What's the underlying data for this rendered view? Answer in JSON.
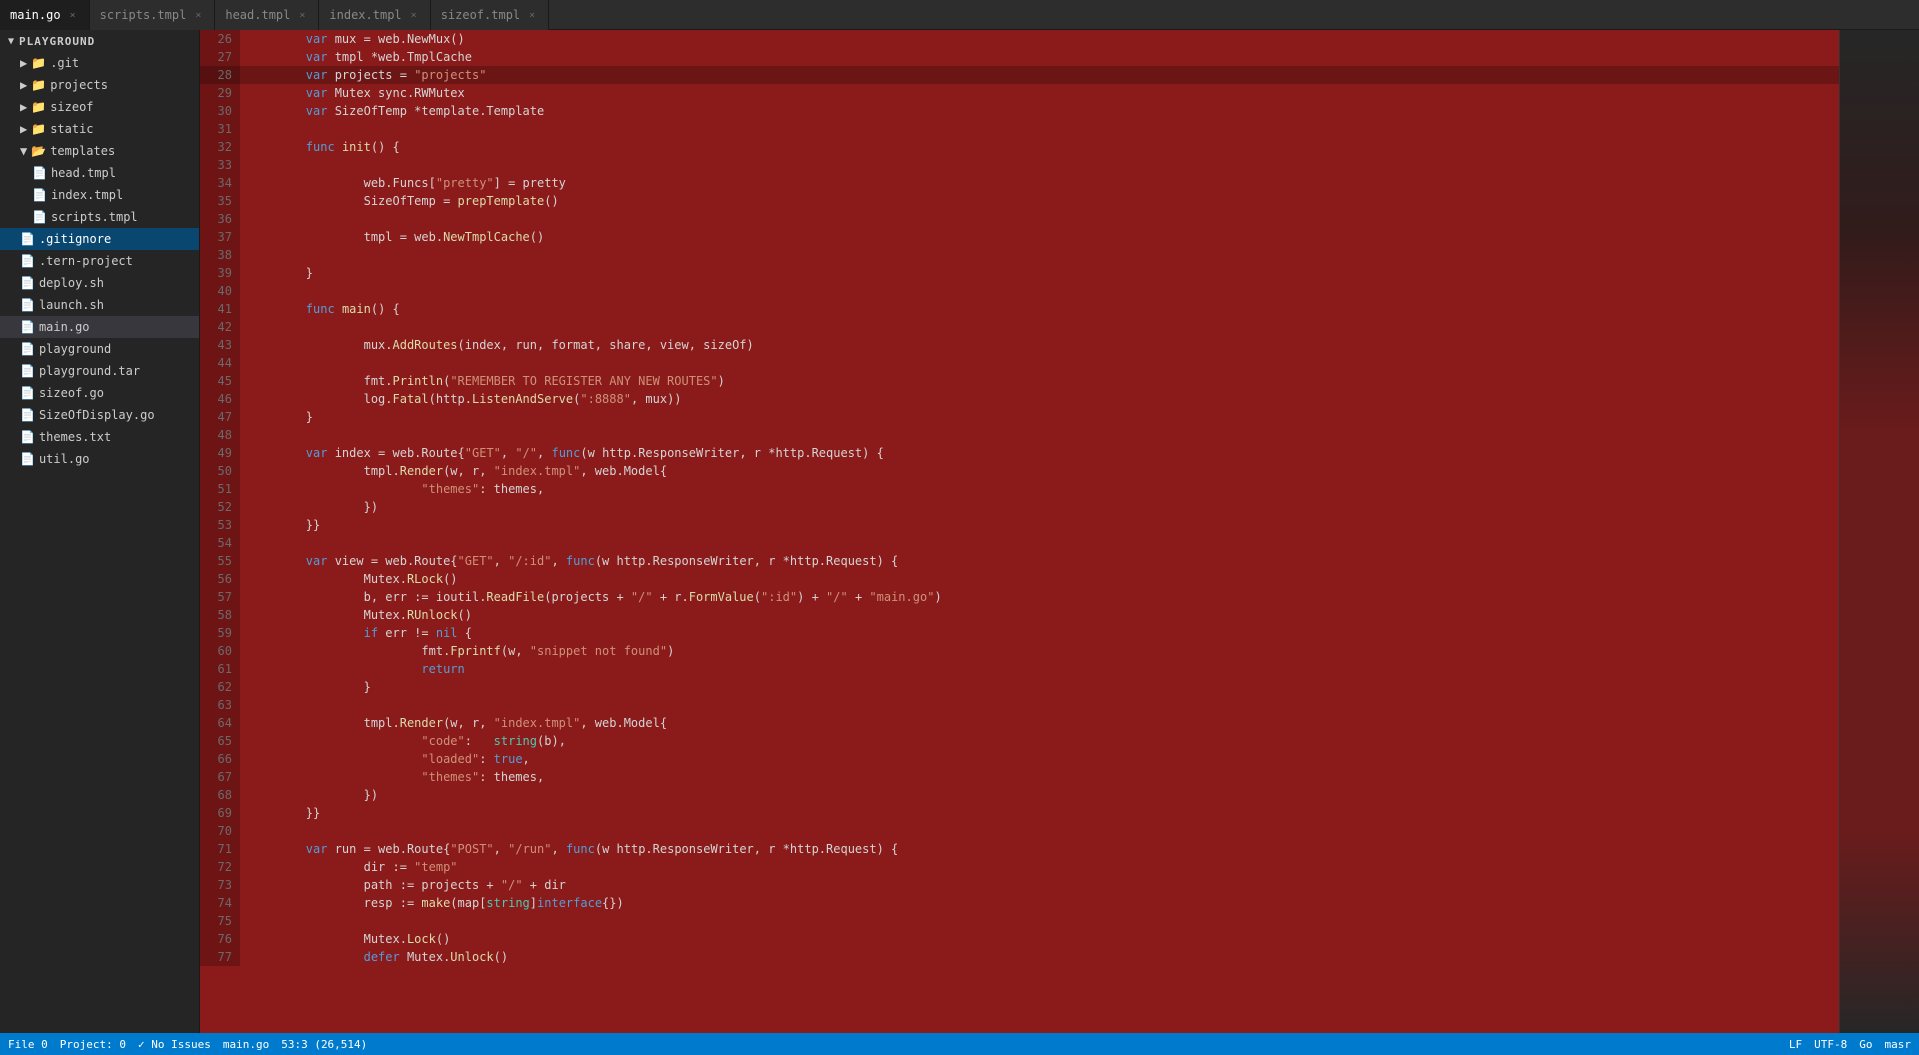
{
  "app": {
    "title": "playground"
  },
  "tabs": [
    {
      "id": "main.go",
      "label": "main.go",
      "active": true,
      "modified": false
    },
    {
      "id": "scripts.tmpl",
      "label": "scripts.tmpl",
      "active": false,
      "modified": false
    },
    {
      "id": "head.tmpl",
      "label": "head.tmpl",
      "active": false,
      "modified": false
    },
    {
      "id": "index.tmpl",
      "label": "index.tmpl",
      "active": false,
      "modified": false
    },
    {
      "id": "sizeof.tmpl",
      "label": "sizeof.tmpl",
      "active": false,
      "modified": false
    }
  ],
  "sidebar": {
    "root_label": "playground",
    "items": [
      {
        "id": "git",
        "label": ".git",
        "type": "folder",
        "indent": 1,
        "collapsed": true
      },
      {
        "id": "projects",
        "label": "projects",
        "type": "folder",
        "indent": 1,
        "collapsed": true
      },
      {
        "id": "sizeof",
        "label": "sizeof",
        "type": "folder",
        "indent": 1,
        "collapsed": true
      },
      {
        "id": "static",
        "label": "static",
        "type": "folder",
        "indent": 1,
        "collapsed": true
      },
      {
        "id": "templates",
        "label": "templates",
        "type": "folder",
        "indent": 1,
        "collapsed": false
      },
      {
        "id": "head.tmpl",
        "label": "head.tmpl",
        "type": "tmpl",
        "indent": 2
      },
      {
        "id": "index.tmpl",
        "label": "index.tmpl",
        "type": "tmpl",
        "indent": 2
      },
      {
        "id": "scripts.tmpl",
        "label": "scripts.tmpl",
        "type": "tmpl",
        "indent": 2
      },
      {
        "id": ".gitignore",
        "label": ".gitignore",
        "type": "git",
        "indent": 1,
        "selected": true
      },
      {
        "id": ".tern-project",
        "label": ".tern-project",
        "type": "txt",
        "indent": 1
      },
      {
        "id": "deploy.sh",
        "label": "deploy.sh",
        "type": "sh",
        "indent": 1
      },
      {
        "id": "launch.sh",
        "label": "launch.sh",
        "type": "sh",
        "indent": 1
      },
      {
        "id": "main.go",
        "label": "main.go",
        "type": "go",
        "indent": 1,
        "active": true
      },
      {
        "id": "playground",
        "label": "playground",
        "type": "file",
        "indent": 1
      },
      {
        "id": "playground.tar",
        "label": "playground.tar",
        "type": "tar",
        "indent": 1
      },
      {
        "id": "sizeof.go",
        "label": "sizeof.go",
        "type": "go",
        "indent": 1
      },
      {
        "id": "SizeOfDisplay.go",
        "label": "SizeOfDisplay.go",
        "type": "go",
        "indent": 1
      },
      {
        "id": "themes.txt",
        "label": "themes.txt",
        "type": "txt",
        "indent": 1
      },
      {
        "id": "util.go",
        "label": "util.go",
        "type": "go",
        "indent": 1
      }
    ]
  },
  "code": {
    "lines": [
      {
        "num": 26,
        "text": "\tvar mux = web.NewMux()"
      },
      {
        "num": 27,
        "text": "\tvar tmpl *web.TmplCache"
      },
      {
        "num": 28,
        "text": "\tvar projects = \"projects\""
      },
      {
        "num": 29,
        "text": "\tvar Mutex sync.RWMutex"
      },
      {
        "num": 30,
        "text": "\tvar SizeOfTemp *template.Template"
      },
      {
        "num": 31,
        "text": ""
      },
      {
        "num": 32,
        "text": "\tfunc init() {"
      },
      {
        "num": 33,
        "text": ""
      },
      {
        "num": 34,
        "text": "\t\tweb.Funcs[\"pretty\"] = pretty"
      },
      {
        "num": 35,
        "text": "\t\tSizeOfTemp = prepTemplate()"
      },
      {
        "num": 36,
        "text": ""
      },
      {
        "num": 37,
        "text": "\t\ttmpl = web.NewTmplCache()"
      },
      {
        "num": 38,
        "text": ""
      },
      {
        "num": 39,
        "text": "\t}"
      },
      {
        "num": 40,
        "text": ""
      },
      {
        "num": 41,
        "text": "\tfunc main() {"
      },
      {
        "num": 42,
        "text": ""
      },
      {
        "num": 43,
        "text": "\t\tmux.AddRoutes(index, run, format, share, view, sizeOf)"
      },
      {
        "num": 44,
        "text": ""
      },
      {
        "num": 45,
        "text": "\t\tfmt.Println(\"REMEMBER TO REGISTER ANY NEW ROUTES\")"
      },
      {
        "num": 46,
        "text": "\t\tlog.Fatal(http.ListenAndServe(\":8888\", mux))"
      },
      {
        "num": 47,
        "text": "\t}"
      },
      {
        "num": 48,
        "text": ""
      },
      {
        "num": 49,
        "text": "\tvar index = web.Route{\"GET\", \"/\", func(w http.ResponseWriter, r *http.Request) {"
      },
      {
        "num": 50,
        "text": "\t\ttmpl.Render(w, r, \"index.tmpl\", web.Model{"
      },
      {
        "num": 51,
        "text": "\t\t\t\"themes\": themes,"
      },
      {
        "num": 52,
        "text": "\t\t})"
      },
      {
        "num": 53,
        "text": "\t}}"
      },
      {
        "num": 54,
        "text": ""
      },
      {
        "num": 55,
        "text": "\tvar view = web.Route{\"GET\", \"/:id\", func(w http.ResponseWriter, r *http.Request) {"
      },
      {
        "num": 56,
        "text": "\t\tMutex.RLock()"
      },
      {
        "num": 57,
        "text": "\t\tb, err := ioutil.ReadFile(projects + \"/\" + r.FormValue(\":id\") + \"/\" + \"main.go\")"
      },
      {
        "num": 58,
        "text": "\t\tMutex.RUnlock()"
      },
      {
        "num": 59,
        "text": "\t\tif err != nil {"
      },
      {
        "num": 60,
        "text": "\t\t\tfmt.Fprintf(w, \"snippet not found\")"
      },
      {
        "num": 61,
        "text": "\t\t\treturn"
      },
      {
        "num": 62,
        "text": "\t\t}"
      },
      {
        "num": 63,
        "text": ""
      },
      {
        "num": 64,
        "text": "\t\ttmpl.Render(w, r, \"index.tmpl\", web.Model{"
      },
      {
        "num": 65,
        "text": "\t\t\t\"code\":   string(b),"
      },
      {
        "num": 66,
        "text": "\t\t\t\"loaded\": true,"
      },
      {
        "num": 67,
        "text": "\t\t\t\"themes\": themes,"
      },
      {
        "num": 68,
        "text": "\t\t})"
      },
      {
        "num": 69,
        "text": "\t}}"
      },
      {
        "num": 70,
        "text": ""
      },
      {
        "num": 71,
        "text": "\tvar run = web.Route{\"POST\", \"/run\", func(w http.ResponseWriter, r *http.Request) {"
      },
      {
        "num": 72,
        "text": "\t\tdir := \"temp\""
      },
      {
        "num": 73,
        "text": "\t\tpath := projects + \"/\" + dir"
      },
      {
        "num": 74,
        "text": "\t\tresp := make(map[string]interface{})"
      },
      {
        "num": 75,
        "text": ""
      },
      {
        "num": 76,
        "text": "\t\tMutex.Lock()"
      },
      {
        "num": 77,
        "text": "\t\tdefer Mutex.Unlock()"
      }
    ]
  },
  "status_bar": {
    "file_index": "File 0",
    "project": "Project: 0",
    "issues": "✓ No Issues",
    "filename": "main.go",
    "cursor": "53:3  (26,514)",
    "line_ending": "LF",
    "encoding": "UTF-8",
    "language": "Go",
    "masn": "masr"
  },
  "colors": {
    "selection_bg": "#8b1a1a",
    "active_tab_bg": "#1e1e1e",
    "inactive_tab_bg": "#2d2d2d",
    "sidebar_bg": "#252526",
    "status_bg": "#007acc"
  }
}
